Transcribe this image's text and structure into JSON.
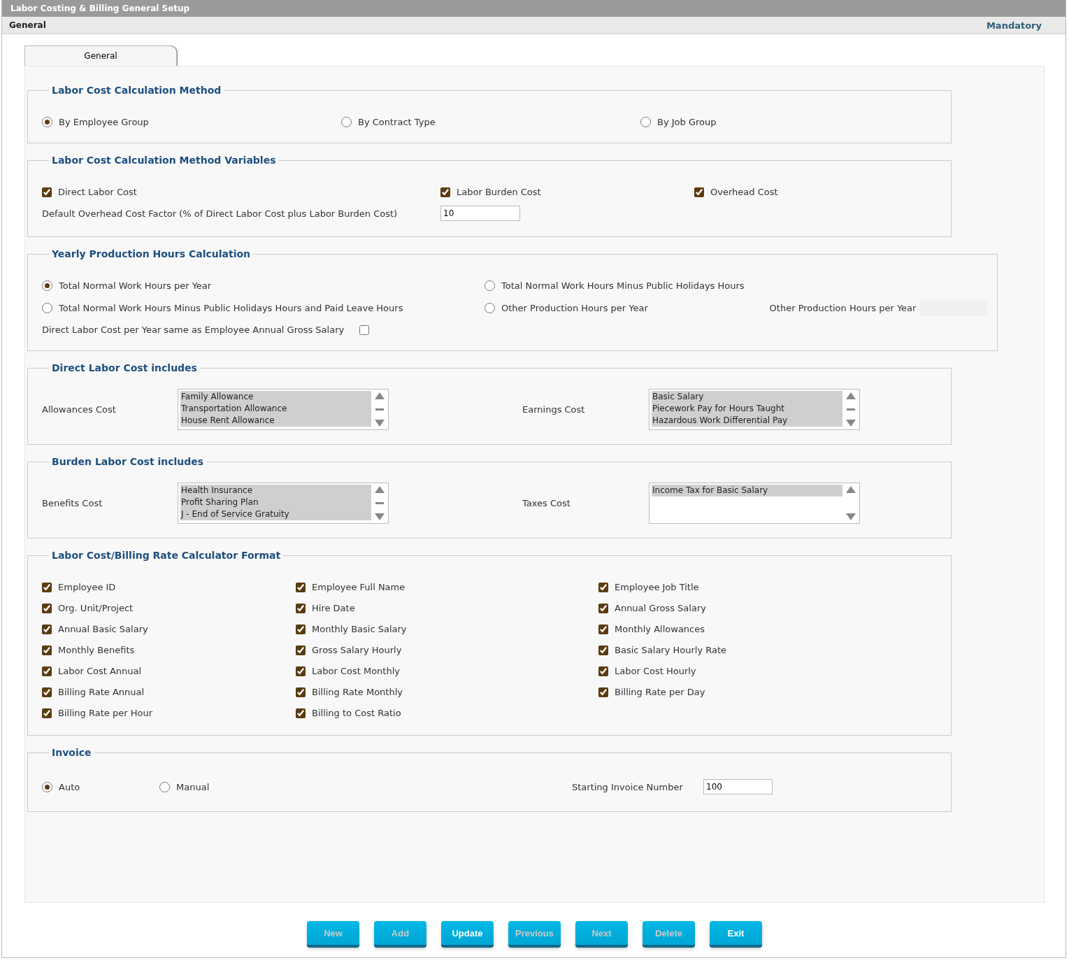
{
  "window": {
    "title": "Labor Costing & Billing General Setup"
  },
  "header": {
    "section": "General",
    "mandatory": "Mandatory"
  },
  "tabs": [
    {
      "label": "General",
      "selected": true
    }
  ],
  "calculation_method": {
    "legend": "Labor Cost Calculation Method",
    "options": [
      {
        "label": "By Employee Group",
        "selected": true
      },
      {
        "label": "By Contract Type",
        "selected": false
      },
      {
        "label": "By Job Group",
        "selected": false
      }
    ]
  },
  "method_variables": {
    "legend": "Labor Cost Calculation Method Variables",
    "checks": [
      {
        "label": "Direct Labor Cost",
        "checked": true
      },
      {
        "label": "Labor Burden Cost",
        "checked": true
      },
      {
        "label": "Overhead Cost",
        "checked": true
      }
    ],
    "overhead_label": "Default Overhead Cost Factor (% of Direct Labor Cost plus Labor Burden Cost)",
    "overhead_value": "10"
  },
  "yearly_hours": {
    "legend": "Yearly Production Hours Calculation",
    "options": [
      {
        "label": "Total Normal Work Hours per Year",
        "selected": true
      },
      {
        "label": "Total Normal Work Hours Minus Public Holidays Hours",
        "selected": false
      },
      {
        "label": "Total Normal Work Hours Minus Public Holidays Hours and Paid Leave Hours",
        "selected": false
      },
      {
        "label": "Other Production Hours per Year",
        "selected": false
      }
    ],
    "other_hours_label": "Other Production Hours per Year",
    "other_hours_disabled": true,
    "same_as_gross_label": "Direct Labor Cost per Year same as Employee Annual Gross Salary",
    "same_as_gross_checked": false
  },
  "list_sections": [
    {
      "legend": "Direct Labor Cost includes",
      "lists": [
        {
          "label": "Allowances Cost",
          "items": [
            {
              "text": "Family Allowance",
              "selected": true
            },
            {
              "text": "Transportation Allowance",
              "selected": true
            },
            {
              "text": "House Rent Allowance",
              "selected": true
            }
          ]
        },
        {
          "label": "Earnings Cost",
          "items": [
            {
              "text": "Basic Salary",
              "selected": true
            },
            {
              "text": "Piecework Pay for Hours Taught",
              "selected": true
            },
            {
              "text": "Hazardous Work Differential Pay",
              "selected": true
            }
          ]
        }
      ]
    },
    {
      "legend": "Burden Labor Cost includes",
      "lists": [
        {
          "label": "Benefits Cost",
          "items": [
            {
              "text": "Health Insurance",
              "selected": true
            },
            {
              "text": "Profit Sharing Plan",
              "selected": true
            },
            {
              "text": "J - End of Service Gratuity",
              "selected": true
            }
          ]
        },
        {
          "label": "Taxes Cost",
          "items": [
            {
              "text": "Income Tax for Basic Salary",
              "selected": true
            }
          ]
        }
      ]
    }
  ],
  "calculator_format": {
    "legend": "Labor Cost/Billing Rate Calculator Format",
    "columns": [
      [
        {
          "label": "Employee ID",
          "checked": true
        },
        {
          "label": "Org. Unit/Project",
          "checked": true
        },
        {
          "label": "Annual Basic Salary",
          "checked": true
        },
        {
          "label": "Monthly Benefits",
          "checked": true
        },
        {
          "label": "Labor Cost Annual",
          "checked": true
        },
        {
          "label": "Billing Rate Annual",
          "checked": true
        },
        {
          "label": "Billing Rate per Hour",
          "checked": true
        }
      ],
      [
        {
          "label": "Employee Full Name",
          "checked": true
        },
        {
          "label": "Hire Date",
          "checked": true
        },
        {
          "label": "Monthly Basic Salary",
          "checked": true
        },
        {
          "label": "Gross Salary Hourly",
          "checked": true
        },
        {
          "label": "Labor Cost Monthly",
          "checked": true
        },
        {
          "label": "Billing Rate Monthly",
          "checked": true
        },
        {
          "label": "Billing to Cost Ratio",
          "checked": true
        }
      ],
      [
        {
          "label": "Employee Job Title",
          "checked": true
        },
        {
          "label": "Annual Gross Salary",
          "checked": true
        },
        {
          "label": "Monthly Allowances",
          "checked": true
        },
        {
          "label": "Basic Salary Hourly Rate",
          "checked": true
        },
        {
          "label": "Labor Cost Hourly",
          "checked": true
        },
        {
          "label": "Billing Rate per Day",
          "checked": true
        }
      ]
    ]
  },
  "invoice": {
    "legend": "Invoice",
    "options": [
      {
        "label": "Auto",
        "selected": true
      },
      {
        "label": "Manual",
        "selected": false
      }
    ],
    "start_label": "Starting Invoice Number",
    "start_value": "100"
  },
  "buttons": [
    {
      "label": "New",
      "disabled": true
    },
    {
      "label": "Add",
      "disabled": true
    },
    {
      "label": "Update",
      "disabled": false
    },
    {
      "label": "Previous",
      "disabled": true
    },
    {
      "label": "Next",
      "disabled": true
    },
    {
      "label": "Delete",
      "disabled": true
    },
    {
      "label": "Exit",
      "disabled": false
    }
  ]
}
